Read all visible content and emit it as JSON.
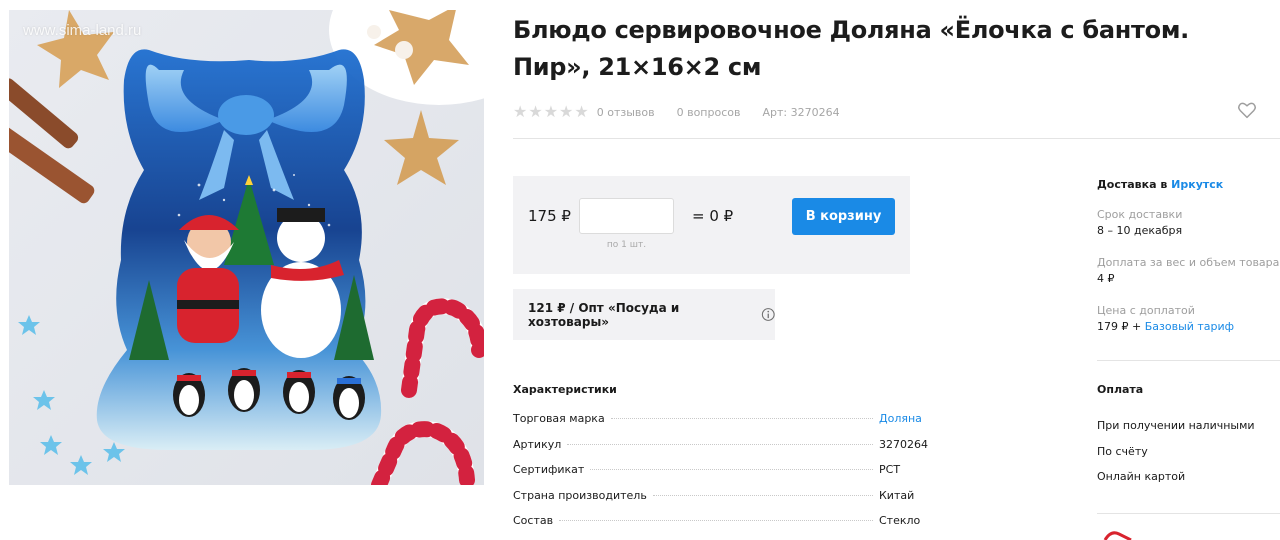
{
  "image": {
    "watermark": "www.sima-land.ru"
  },
  "product": {
    "title": "Блюдо сервировочное Доляна «Ёлочка с бантом. Пир», 21×16×2 см",
    "rating": 0,
    "reviews": "0 отзывов",
    "questions": "0 вопросов",
    "article": "Арт: 3270264"
  },
  "buy": {
    "price": "175 ₽",
    "qty_value": "",
    "qty_hint": "по 1 шт.",
    "total": "= 0 ₽",
    "cart_button": "В корзину",
    "wholesale": "121 ₽ / Опт «Посуда и хозтовары»"
  },
  "characteristics": {
    "title": "Характеристики",
    "rows": [
      {
        "key": "Торговая марка",
        "value": "Доляна",
        "link": true
      },
      {
        "key": "Артикул",
        "value": "3270264",
        "link": false
      },
      {
        "key": "Сертификат",
        "value": "РСТ",
        "link": false
      },
      {
        "key": "Страна производитель",
        "value": "Китай",
        "link": false
      },
      {
        "key": "Состав",
        "value": "Стекло",
        "link": false
      }
    ]
  },
  "delivery": {
    "head_prefix": "Доставка в",
    "city": "Иркутск",
    "term_label": "Срок доставки",
    "term_value": "8 – 10 декабря",
    "surcharge_label": "Доплата за вес и объем товара",
    "surcharge_value": "4 ₽",
    "price_label": "Цена с доплатой",
    "price_value": "179 ₽ +",
    "tariff": "Базовый тариф"
  },
  "payment": {
    "title": "Оплата",
    "items": [
      "При получении наличными",
      "По счёту",
      "Онлайн картой"
    ]
  },
  "colors": {
    "accent": "#1a8ae6",
    "box_bg": "#f2f2f4",
    "muted": "#a6a6a6"
  },
  "icons": [
    "heart-icon",
    "info-icon",
    "star-icon"
  ]
}
